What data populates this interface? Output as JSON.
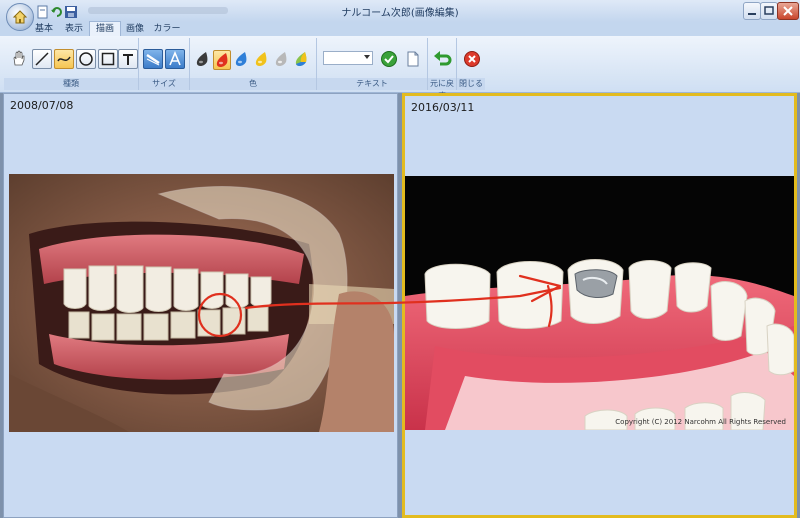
{
  "window": {
    "title": "ナルコーム次郎(画像編集)"
  },
  "tabs": [
    {
      "label": "基本",
      "active": false
    },
    {
      "label": "表示",
      "active": false
    },
    {
      "label": "描画",
      "active": true
    },
    {
      "label": "画像",
      "active": false
    },
    {
      "label": "カラー",
      "active": false
    }
  ],
  "ribbon": {
    "groups": {
      "type_label": "種類",
      "size_label": "サイズ",
      "color_label": "色",
      "text_label": "テキスト",
      "undo_label": "元に戻す",
      "close_label": "閉じる"
    },
    "tools": [
      "hand-tool",
      "line-tool",
      "freehand-tool",
      "circle-tool",
      "rectangle-tool",
      "text-tool"
    ],
    "selected_tool": "freehand-tool",
    "pen_colors": [
      "#3b3b3b",
      "#e0301e",
      "#2f7fd8",
      "#f1c21b",
      "#b8b8b8",
      "multicolor"
    ],
    "selected_color": "#e0301e",
    "text_select_value": ""
  },
  "panes": {
    "left": {
      "date": "2008/07/08"
    },
    "right": {
      "date": "2016/03/11",
      "copyright": "Copyright (C) 2012 Narcohm All Rights Reserved"
    }
  },
  "annotation_color": "#e0301e"
}
